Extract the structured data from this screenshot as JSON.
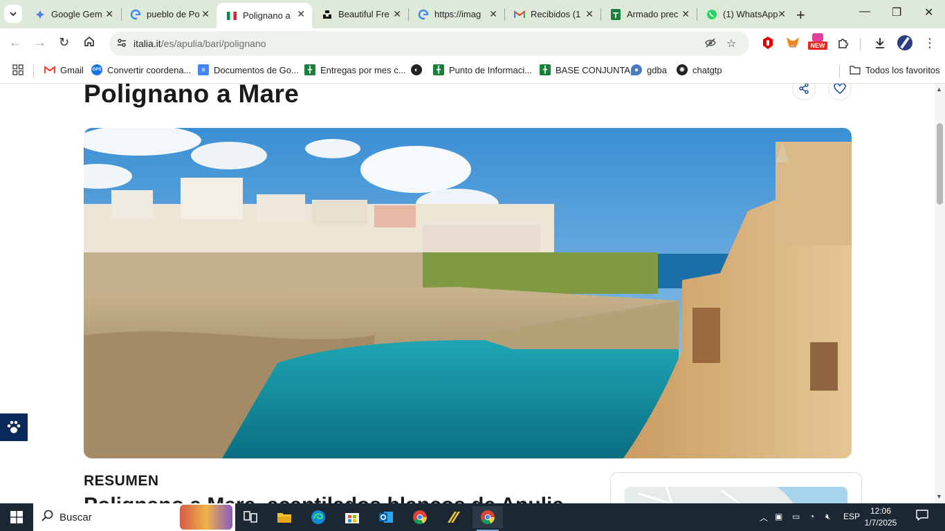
{
  "tabs": [
    {
      "label": "Google Gem",
      "icon": "gemini-icon",
      "color": "#4285f4"
    },
    {
      "label": "pueblo de Po",
      "icon": "google-icon",
      "color": "#4285f4"
    },
    {
      "label": "Polignano a",
      "icon": "italy-flag-icon",
      "color": "#009246"
    },
    {
      "label": "Beautiful Fre",
      "icon": "unsplash-icon",
      "color": "#111111"
    },
    {
      "label": "https://imag",
      "icon": "google-icon",
      "color": "#4285f4"
    },
    {
      "label": "Recibidos (1",
      "icon": "gmail-icon",
      "color": "#ea4335"
    },
    {
      "label": "Armado prec",
      "icon": "sheets-icon",
      "color": "#188038"
    },
    {
      "label": "(1) WhatsApp",
      "icon": "whatsapp-icon",
      "color": "#25d366"
    }
  ],
  "address": {
    "domain": "italia.it",
    "path": "/es/apulia/bari/polignano"
  },
  "extensions": {
    "badge": "NEW"
  },
  "bookmarks": [
    {
      "label": "Gmail",
      "icon": "gmail-icon",
      "color": "#ea4335"
    },
    {
      "label": "Convertir coordena...",
      "icon": "gps-icon",
      "color": "#1a73e8"
    },
    {
      "label": "Documentos de Go...",
      "icon": "docs-icon",
      "color": "#4285f4"
    },
    {
      "label": "Entregas por mes c...",
      "icon": "sheets-icon",
      "color": "#188038"
    },
    {
      "label": "",
      "icon": "globe-icon",
      "color": "#222222"
    },
    {
      "label": "Punto de Informaci...",
      "icon": "sheets-icon",
      "color": "#188038"
    },
    {
      "label": "BASE CONJUNTA",
      "icon": "sheets-icon",
      "color": "#188038"
    },
    {
      "label": "gdba",
      "icon": "gdba-icon",
      "color": "#4a7cc0"
    },
    {
      "label": "chatgtp",
      "icon": "chatgpt-icon",
      "color": "#222222"
    },
    {
      "label": "Todos los favoritos",
      "icon": "folder-icon",
      "color": "#444444"
    }
  ],
  "page": {
    "title": "Polignano a Mare",
    "section": "RESUMEN",
    "subheading": "Polignano a Mare, acantilados blancos de Apulia"
  },
  "taskbar": {
    "search_placeholder": "Buscar",
    "language": "ESP",
    "time": "12:06",
    "date": "1/7/2025"
  }
}
